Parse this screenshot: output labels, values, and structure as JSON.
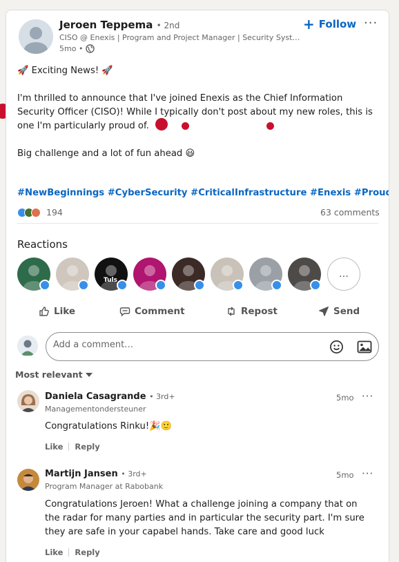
{
  "author": {
    "name": "Jeroen Teppema",
    "degree": "• 2nd",
    "headline": "CISO @ Enexis | Program and Project Manager | Security Syst…",
    "time": "5mo •"
  },
  "header_actions": {
    "follow_label": "Follow",
    "more_label": "···"
  },
  "post": {
    "line1": "🚀 Exciting News! 🚀",
    "para1": "I'm thrilled to announce that I've joined Enexis as the Chief Information Security Officer (CISO)! While I typically don't post about my new roles, this is one I'm particularly proud of.",
    "line2": "Big challenge and a lot of fun ahead 😃",
    "hashtags": [
      "#NewBeginnings",
      "#CyberSecurity",
      "#CriticalInfrastructure",
      "#Enexis",
      "#ProudCISO"
    ]
  },
  "social": {
    "reaction_count": "194",
    "comments_count": "63 comments"
  },
  "reactions": {
    "title": "Reactions",
    "more_label": "…",
    "people": [
      {
        "name": "reactor-1",
        "bg": "#2e6b4a"
      },
      {
        "name": "reactor-2",
        "bg": "#cfc7bd"
      },
      {
        "name": "reactor-3",
        "bg": "#111111",
        "label": "Tuls"
      },
      {
        "name": "reactor-4",
        "bg": "#b0156f"
      },
      {
        "name": "reactor-5",
        "bg": "#3b2a26"
      },
      {
        "name": "reactor-6",
        "bg": "#c9c2b8"
      },
      {
        "name": "reactor-7",
        "bg": "#9aa0a6"
      },
      {
        "name": "reactor-8",
        "bg": "#4d4a47"
      }
    ]
  },
  "actions": {
    "like": "Like",
    "comment": "Comment",
    "repost": "Repost",
    "send": "Send"
  },
  "comment_box": {
    "placeholder": "Add a comment…"
  },
  "sort": {
    "label": "Most relevant"
  },
  "comments": [
    {
      "name": "Daniela Casagrande",
      "degree": "• 3rd+",
      "headline": "Managementondersteuner",
      "time": "5mo",
      "text": "Congratulations Rinku!🎉🙂",
      "like": "Like",
      "reply": "Reply"
    },
    {
      "name": "Martijn Jansen",
      "degree": "• 3rd+",
      "headline": "Program Manager at Rabobank",
      "time": "5mo",
      "text": "Congratulations Jeroen! What a challenge joining a company that on the radar for many parties and in particular the security part. I'm sure they are safe in your capabel hands. Take care and good luck",
      "like": "Like",
      "reply": "Reply"
    }
  ],
  "colors": {
    "accent": "#0a66c2",
    "like_blue": "#378fe9"
  }
}
